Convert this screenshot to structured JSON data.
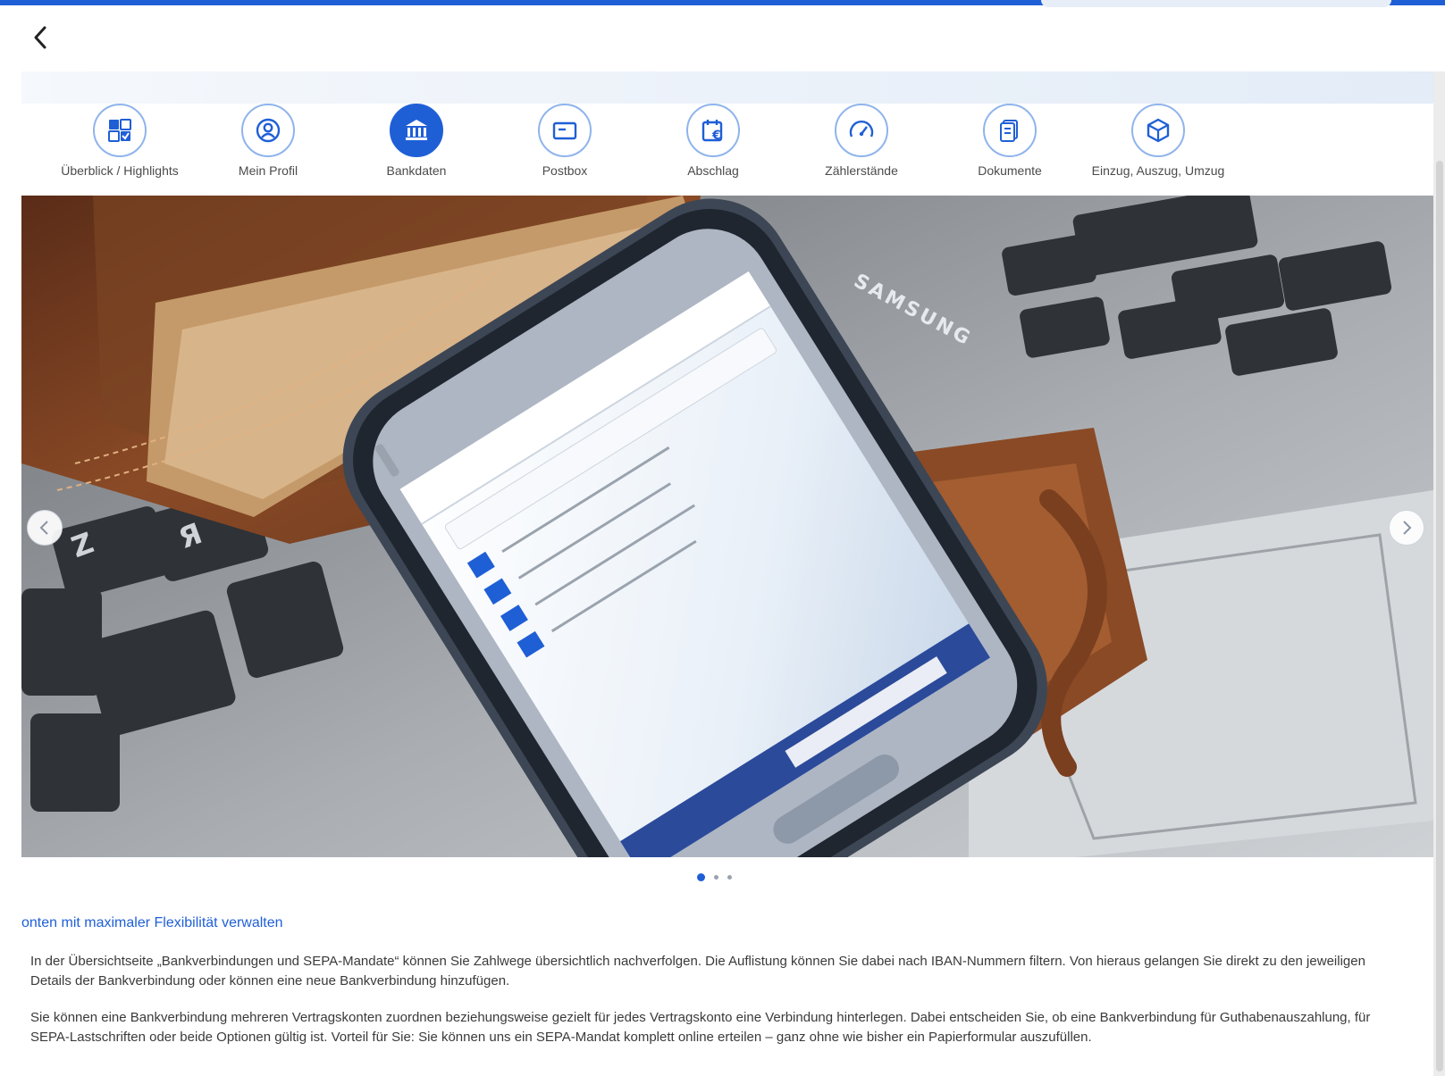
{
  "nav": {
    "items": [
      {
        "label": "Überblick / Highlights",
        "icon": "overview-grid-icon",
        "active": false
      },
      {
        "label": "Mein Profil",
        "icon": "profile-icon",
        "active": false
      },
      {
        "label": "Bankdaten",
        "icon": "bank-icon",
        "active": true
      },
      {
        "label": "Postbox",
        "icon": "postbox-icon",
        "active": false
      },
      {
        "label": "Abschlag",
        "icon": "calendar-euro-icon",
        "active": false
      },
      {
        "label": "Zählerstände",
        "icon": "gauge-icon",
        "active": false
      },
      {
        "label": "Dokumente",
        "icon": "documents-icon",
        "active": false
      },
      {
        "label": "Einzug, Auszug, Umzug",
        "icon": "move-box-icon",
        "active": false
      }
    ]
  },
  "slider": {
    "phone_brand": "SAMSUNG",
    "dots": 3,
    "active_dot": 0
  },
  "content": {
    "heading": "onten mit maximaler Flexibilität verwalten",
    "paragraph1": "In der Übersichtseite „Bankverbindungen und SEPA-Mandate“ können Sie Zahlwege übersichtlich nachverfolgen. Die Auflistung können Sie dabei nach IBAN-Nummern filtern. Von hieraus gelangen Sie direkt zu den jeweiligen Details der Bankverbindung oder können eine neue Bankverbindung hinzufügen.",
    "paragraph2": "Sie können eine Bankverbindung mehreren Vertragskonten zuordnen beziehungsweise gezielt für jedes Vertragskonto eine Verbindung hinterlegen. Dabei entscheiden Sie, ob eine Bankverbindung für Guthabenauszahlung, für SEPA-Lastschriften oder beide Optionen gültig ist. Vorteil für Sie: Sie können uns ein SEPA-Mandat komplett online erteilen – ganz ohne wie bisher ein Papierformular auszufüllen."
  },
  "colors": {
    "accent": "#1f5fd6",
    "nav_ring": "#8fb4ec"
  }
}
